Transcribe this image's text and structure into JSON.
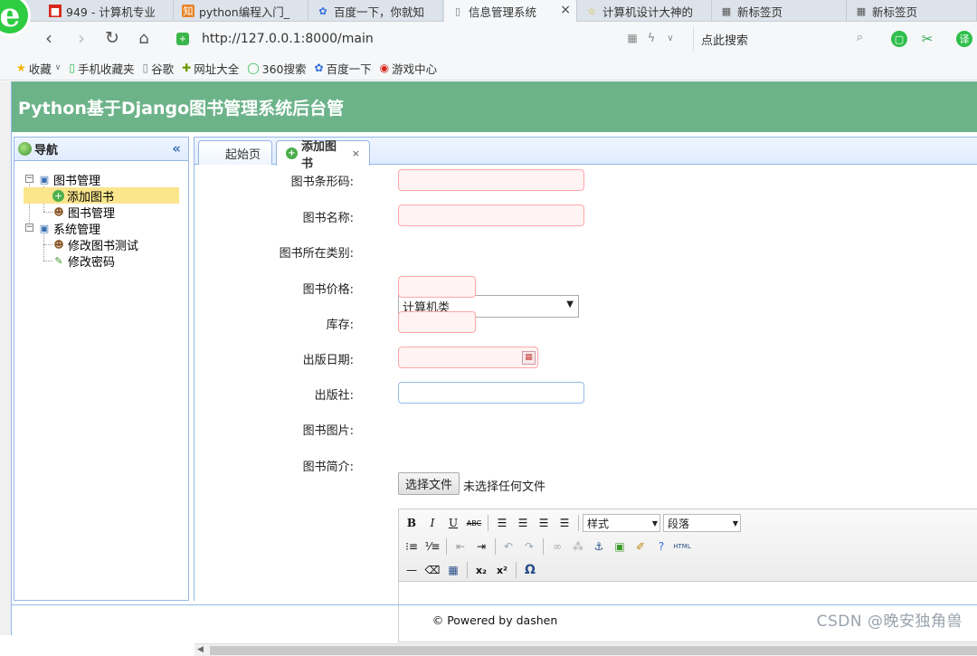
{
  "browser": {
    "tabs": [
      {
        "label": "949 - 计算机专业",
        "icon": "red-square-icon"
      },
      {
        "label": "python编程入门_",
        "icon": "orange-badge-icon"
      },
      {
        "label": "百度一下，你就知",
        "icon": "baidu-paw-icon"
      },
      {
        "label": "信息管理系统",
        "icon": "page-icon"
      },
      {
        "label": "计算机设计大神的",
        "icon": "star-icon"
      },
      {
        "label": "新标签页",
        "icon": "grid-icon"
      },
      {
        "label": "新标签页",
        "icon": "grid-icon"
      }
    ],
    "active_tab_close": "×",
    "url": "http://127.0.0.1:8000/main",
    "search_placeholder": "点此搜索",
    "bookmarks": [
      {
        "label": "收藏",
        "icon": "star-icon"
      },
      {
        "label": "手机收藏夹",
        "icon": "phone-icon"
      },
      {
        "label": "谷歌",
        "icon": "page-icon"
      },
      {
        "label": "网址大全",
        "icon": "plus-circle-icon"
      },
      {
        "label": "360搜索",
        "icon": "ring-icon"
      },
      {
        "label": "百度一下",
        "icon": "baidu-paw-icon"
      },
      {
        "label": "游戏中心",
        "icon": "game-icon"
      }
    ]
  },
  "app": {
    "title": "Python基于Django图书管理系统后台管",
    "nav": {
      "header": "导航",
      "collapse": "«",
      "tree": [
        {
          "label": "图书管理",
          "icon": "computer-icon"
        },
        {
          "label": "添加图书",
          "icon": "add-circle-icon"
        },
        {
          "label": "图书管理",
          "icon": "user-icon"
        },
        {
          "label": "系统管理",
          "icon": "computer-icon"
        },
        {
          "label": "修改图书测试",
          "icon": "user-icon"
        },
        {
          "label": "修改密码",
          "icon": "pencil-icon"
        }
      ]
    },
    "tabs": [
      {
        "label": "起始页"
      },
      {
        "label": "添加图书",
        "close": "×"
      }
    ],
    "form": {
      "barcode_label": "图书条形码:",
      "name_label": "图书名称:",
      "category_label": "图书所在类别:",
      "category_value": "计算机类",
      "price_label": "图书价格:",
      "stock_label": "库存:",
      "pubdate_label": "出版日期:",
      "publisher_label": "出版社:",
      "image_label": "图书图片:",
      "file_button": "选择文件",
      "file_status": "未选择任何文件",
      "intro_label": "图书简介:"
    },
    "editor": {
      "style_select": "样式",
      "paragraph_select": "段落",
      "html_label": "HTML"
    },
    "footer": "© Powered by dashen"
  },
  "watermark": "CSDN @晚安独角兽"
}
